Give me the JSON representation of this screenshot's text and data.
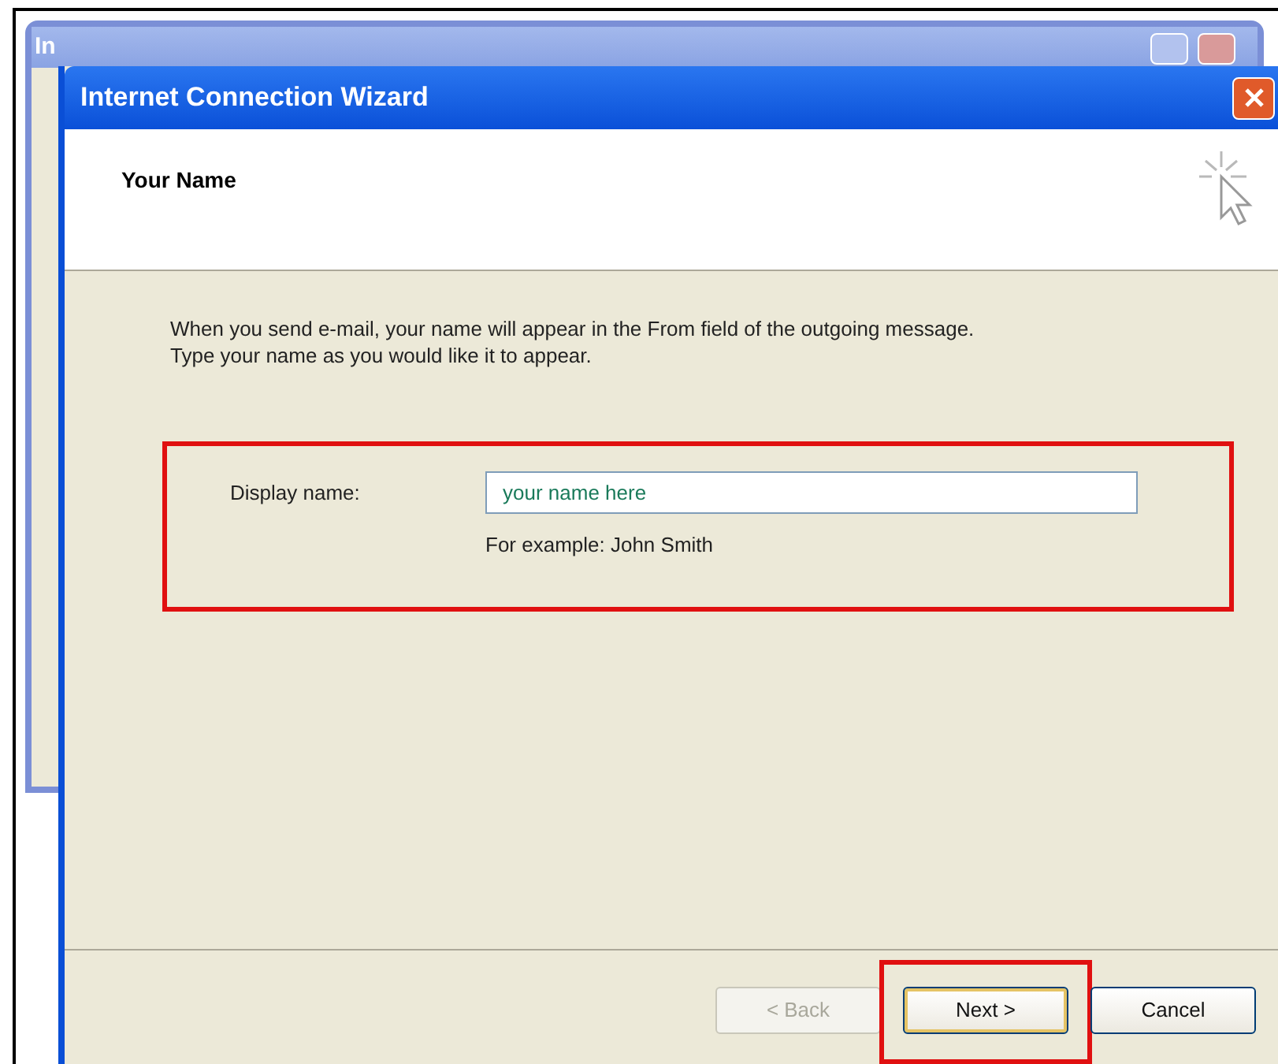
{
  "background_window": {
    "title": "In"
  },
  "window": {
    "title": "Internet Connection Wizard"
  },
  "header": {
    "title": "Your Name"
  },
  "intro": "When you send e-mail, your name will appear in the From field of the outgoing message.\nType your name as you would like it to appear.",
  "display_name": {
    "label": "Display name:",
    "value": "your name here",
    "hint": "For example: John Smith",
    "highlighted": true
  },
  "buttons": [
    {
      "kind": "back",
      "label": "< Back",
      "disabled": true,
      "highlighted": false
    },
    {
      "kind": "next",
      "label": "Next >",
      "disabled": false,
      "highlighted": true
    },
    {
      "kind": "cancel",
      "label": "Cancel",
      "disabled": false,
      "highlighted": false
    }
  ]
}
